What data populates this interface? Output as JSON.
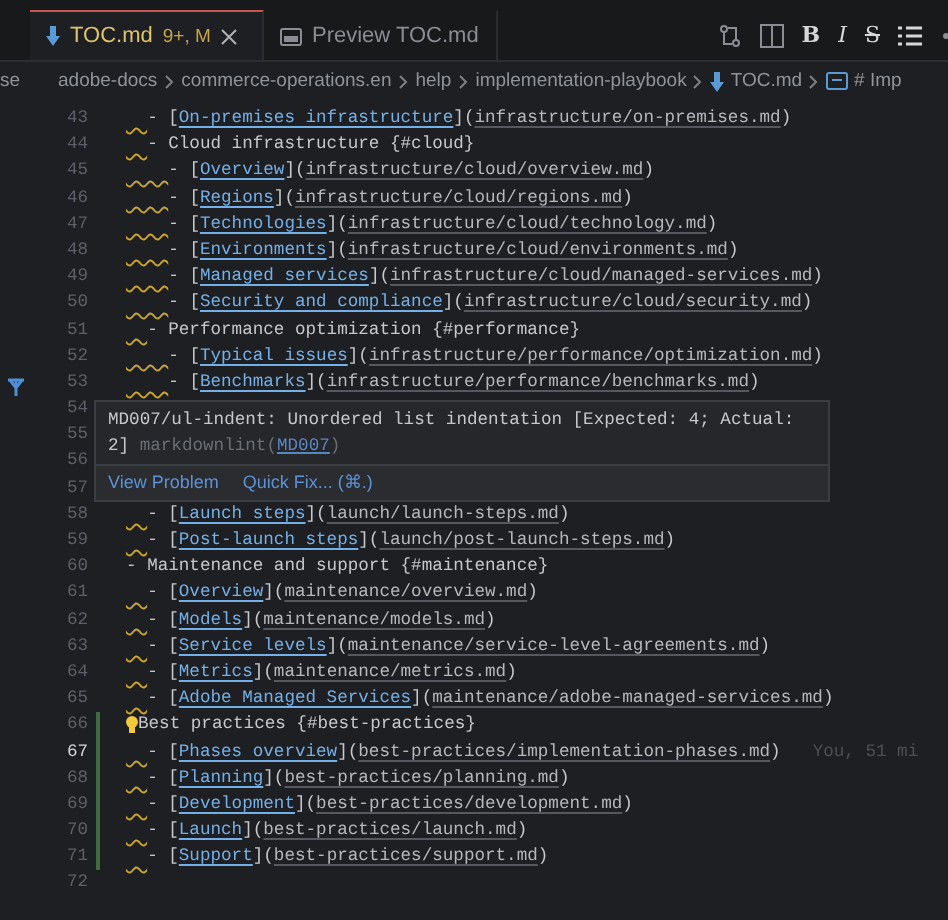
{
  "tabs": [
    {
      "title": "TOC.md",
      "badge": "9+, M",
      "selected": true,
      "kind": "markdown"
    },
    {
      "title": "Preview TOC.md",
      "selected": false,
      "kind": "preview"
    }
  ],
  "format_buttons": [
    "B",
    "I",
    "S"
  ],
  "sidebar": {
    "label": "se"
  },
  "breadcrumb": [
    "adobe-docs",
    "commerce-operations.en",
    "help",
    "implementation-playbook",
    "TOC.md",
    "# Imp"
  ],
  "lines": [
    {
      "number": "43",
      "text": "  - [On-premises infrastructure](infrastructure/on-premises.md)",
      "warning": true
    },
    {
      "number": "44",
      "text": "  - Cloud infrastructure {#cloud}",
      "warning": true
    },
    {
      "number": "45",
      "text": "    - [Overview](infrastructure/cloud/overview.md)",
      "warning": true
    },
    {
      "number": "46",
      "text": "    - [Regions](infrastructure/cloud/regions.md)",
      "warning": true
    },
    {
      "number": "47",
      "text": "    - [Technologies](infrastructure/cloud/technology.md)",
      "warning": true
    },
    {
      "number": "48",
      "text": "    - [Environments](infrastructure/cloud/environments.md)",
      "warning": true
    },
    {
      "number": "49",
      "text": "    - [Managed services](infrastructure/cloud/managed-services.md)",
      "warning": true
    },
    {
      "number": "50",
      "text": "    - [Security and compliance](infrastructure/cloud/security.md)",
      "warning": true
    },
    {
      "number": "51",
      "text": "  - Performance optimization {#performance}",
      "warning": true
    },
    {
      "number": "52",
      "text": "    - [Typical issues](infrastructure/performance/optimization.md)",
      "warning": true
    },
    {
      "number": "53",
      "text": "    - [Benchmarks](infrastructure/performance/benchmarks.md)",
      "warning": true
    },
    {
      "number": "54"
    },
    {
      "number": "55"
    },
    {
      "number": "56"
    },
    {
      "number": "57"
    },
    {
      "number": "58",
      "text": "  - [Launch steps](launch/launch-steps.md)",
      "warning": true
    },
    {
      "number": "59",
      "text": "  - [Post-launch steps](launch/post-launch-steps.md)",
      "warning": true
    },
    {
      "number": "60",
      "text": "- Maintenance and support {#maintenance}",
      "warning": false
    },
    {
      "number": "61",
      "text": "  - [Overview](maintenance/overview.md)",
      "warning": true
    },
    {
      "number": "62",
      "text": "  - [Models](maintenance/models.md)",
      "warning": true
    },
    {
      "number": "63",
      "text": "  - [Service levels](maintenance/service-level-agreements.md)",
      "warning": true
    },
    {
      "number": "64",
      "text": "  - [Metrics](maintenance/metrics.md)",
      "warning": true
    },
    {
      "number": "65",
      "text": "  - [Adobe Managed Services](maintenance/adobe-managed-services.md)",
      "warning": true
    },
    {
      "number": "66",
      "text": "Best practices {#best-practices}",
      "warning": false,
      "lightbulb": true,
      "changed": true
    },
    {
      "number": "67",
      "text": "  - [Phases overview](best-practices/implementation-phases.md)",
      "warning": true,
      "current": true,
      "changed": true,
      "blame": "You, 51 mi"
    },
    {
      "number": "68",
      "text": "  - [Planning](best-practices/planning.md)",
      "warning": true,
      "changed": true
    },
    {
      "number": "69",
      "text": "  - [Development](best-practices/development.md)",
      "warning": true,
      "changed": true
    },
    {
      "number": "70",
      "text": "  - [Launch](best-practices/launch.md)",
      "warning": true,
      "changed": true
    },
    {
      "number": "71",
      "text": "  - [Support](best-practices/support.md)",
      "warning": true,
      "changed": true
    },
    {
      "number": "72"
    }
  ],
  "hover": {
    "message": "MD007/ul-indent: Unordered list indentation [Expected: 4; Actual: 2]",
    "source": "markdownlint(",
    "code": "MD007",
    "source_end": ")",
    "actions": [
      "View Problem",
      "Quick Fix... (⌘.)"
    ]
  }
}
